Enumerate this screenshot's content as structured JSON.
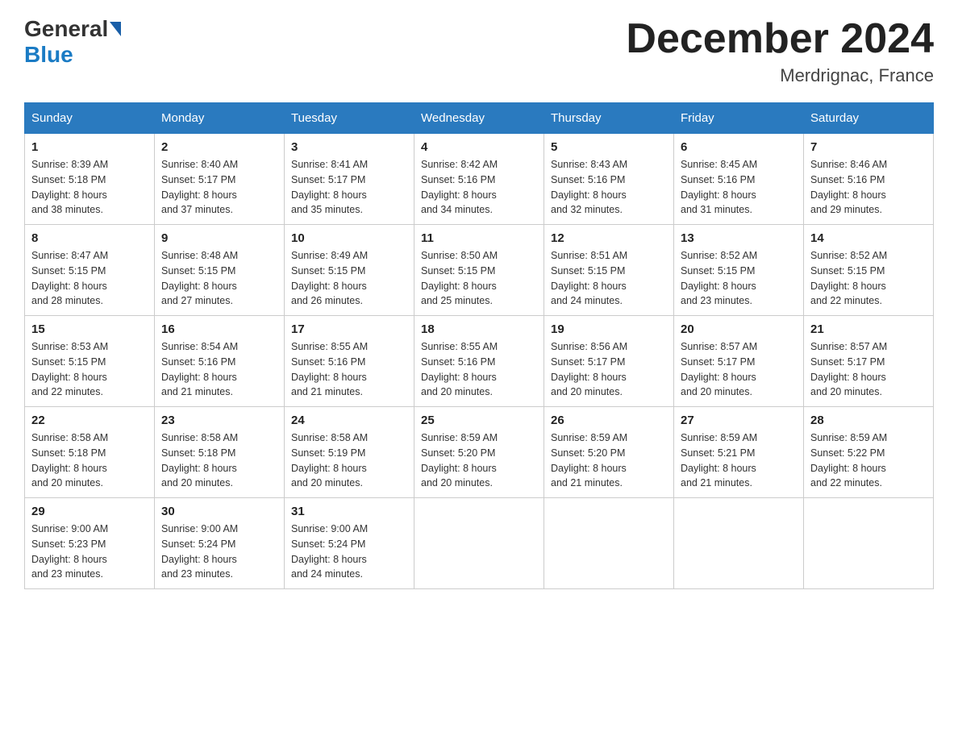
{
  "header": {
    "logo": {
      "general": "General",
      "blue": "Blue"
    },
    "title": "December 2024",
    "location": "Merdrignac, France"
  },
  "days_of_week": [
    "Sunday",
    "Monday",
    "Tuesday",
    "Wednesday",
    "Thursday",
    "Friday",
    "Saturday"
  ],
  "weeks": [
    [
      {
        "day": "1",
        "sunrise": "8:39 AM",
        "sunset": "5:18 PM",
        "daylight": "8 hours and 38 minutes."
      },
      {
        "day": "2",
        "sunrise": "8:40 AM",
        "sunset": "5:17 PM",
        "daylight": "8 hours and 37 minutes."
      },
      {
        "day": "3",
        "sunrise": "8:41 AM",
        "sunset": "5:17 PM",
        "daylight": "8 hours and 35 minutes."
      },
      {
        "day": "4",
        "sunrise": "8:42 AM",
        "sunset": "5:16 PM",
        "daylight": "8 hours and 34 minutes."
      },
      {
        "day": "5",
        "sunrise": "8:43 AM",
        "sunset": "5:16 PM",
        "daylight": "8 hours and 32 minutes."
      },
      {
        "day": "6",
        "sunrise": "8:45 AM",
        "sunset": "5:16 PM",
        "daylight": "8 hours and 31 minutes."
      },
      {
        "day": "7",
        "sunrise": "8:46 AM",
        "sunset": "5:16 PM",
        "daylight": "8 hours and 29 minutes."
      }
    ],
    [
      {
        "day": "8",
        "sunrise": "8:47 AM",
        "sunset": "5:15 PM",
        "daylight": "8 hours and 28 minutes."
      },
      {
        "day": "9",
        "sunrise": "8:48 AM",
        "sunset": "5:15 PM",
        "daylight": "8 hours and 27 minutes."
      },
      {
        "day": "10",
        "sunrise": "8:49 AM",
        "sunset": "5:15 PM",
        "daylight": "8 hours and 26 minutes."
      },
      {
        "day": "11",
        "sunrise": "8:50 AM",
        "sunset": "5:15 PM",
        "daylight": "8 hours and 25 minutes."
      },
      {
        "day": "12",
        "sunrise": "8:51 AM",
        "sunset": "5:15 PM",
        "daylight": "8 hours and 24 minutes."
      },
      {
        "day": "13",
        "sunrise": "8:52 AM",
        "sunset": "5:15 PM",
        "daylight": "8 hours and 23 minutes."
      },
      {
        "day": "14",
        "sunrise": "8:52 AM",
        "sunset": "5:15 PM",
        "daylight": "8 hours and 22 minutes."
      }
    ],
    [
      {
        "day": "15",
        "sunrise": "8:53 AM",
        "sunset": "5:15 PM",
        "daylight": "8 hours and 22 minutes."
      },
      {
        "day": "16",
        "sunrise": "8:54 AM",
        "sunset": "5:16 PM",
        "daylight": "8 hours and 21 minutes."
      },
      {
        "day": "17",
        "sunrise": "8:55 AM",
        "sunset": "5:16 PM",
        "daylight": "8 hours and 21 minutes."
      },
      {
        "day": "18",
        "sunrise": "8:55 AM",
        "sunset": "5:16 PM",
        "daylight": "8 hours and 20 minutes."
      },
      {
        "day": "19",
        "sunrise": "8:56 AM",
        "sunset": "5:17 PM",
        "daylight": "8 hours and 20 minutes."
      },
      {
        "day": "20",
        "sunrise": "8:57 AM",
        "sunset": "5:17 PM",
        "daylight": "8 hours and 20 minutes."
      },
      {
        "day": "21",
        "sunrise": "8:57 AM",
        "sunset": "5:17 PM",
        "daylight": "8 hours and 20 minutes."
      }
    ],
    [
      {
        "day": "22",
        "sunrise": "8:58 AM",
        "sunset": "5:18 PM",
        "daylight": "8 hours and 20 minutes."
      },
      {
        "day": "23",
        "sunrise": "8:58 AM",
        "sunset": "5:18 PM",
        "daylight": "8 hours and 20 minutes."
      },
      {
        "day": "24",
        "sunrise": "8:58 AM",
        "sunset": "5:19 PM",
        "daylight": "8 hours and 20 minutes."
      },
      {
        "day": "25",
        "sunrise": "8:59 AM",
        "sunset": "5:20 PM",
        "daylight": "8 hours and 20 minutes."
      },
      {
        "day": "26",
        "sunrise": "8:59 AM",
        "sunset": "5:20 PM",
        "daylight": "8 hours and 21 minutes."
      },
      {
        "day": "27",
        "sunrise": "8:59 AM",
        "sunset": "5:21 PM",
        "daylight": "8 hours and 21 minutes."
      },
      {
        "day": "28",
        "sunrise": "8:59 AM",
        "sunset": "5:22 PM",
        "daylight": "8 hours and 22 minutes."
      }
    ],
    [
      {
        "day": "29",
        "sunrise": "9:00 AM",
        "sunset": "5:23 PM",
        "daylight": "8 hours and 23 minutes."
      },
      {
        "day": "30",
        "sunrise": "9:00 AM",
        "sunset": "5:24 PM",
        "daylight": "8 hours and 23 minutes."
      },
      {
        "day": "31",
        "sunrise": "9:00 AM",
        "sunset": "5:24 PM",
        "daylight": "8 hours and 24 minutes."
      },
      null,
      null,
      null,
      null
    ]
  ],
  "labels": {
    "sunrise": "Sunrise:",
    "sunset": "Sunset:",
    "daylight": "Daylight:"
  }
}
